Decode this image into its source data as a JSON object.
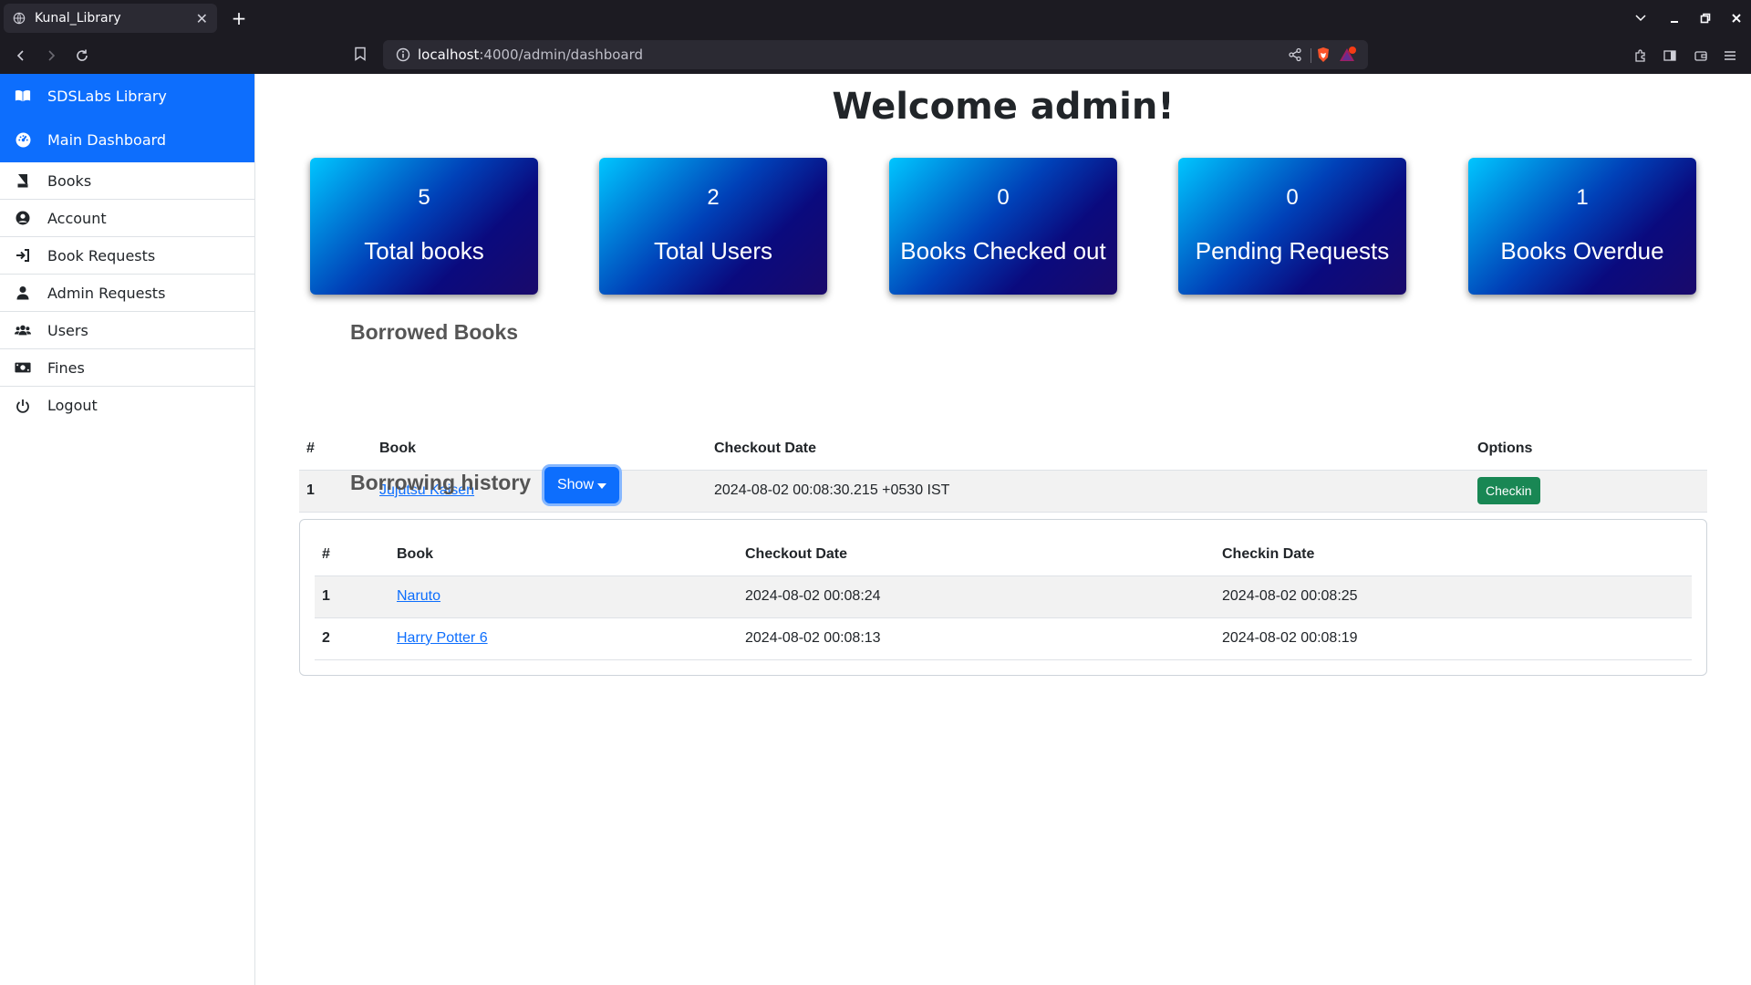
{
  "browser": {
    "tab_title": "Kunal_Library",
    "url_host": "localhost",
    "url_path": ":4000/admin/dashboard"
  },
  "sidebar": {
    "brand": "SDSLabs Library",
    "items": [
      {
        "label": "Main Dashboard",
        "icon": "dashboard-icon",
        "active": true
      },
      {
        "label": "Books",
        "icon": "book-icon"
      },
      {
        "label": "Account",
        "icon": "user-circle-icon"
      },
      {
        "label": "Book Requests",
        "icon": "sign-in-icon"
      },
      {
        "label": "Admin Requests",
        "icon": "user-tie-icon"
      },
      {
        "label": "Users",
        "icon": "users-icon"
      },
      {
        "label": "Fines",
        "icon": "money-icon"
      },
      {
        "label": "Logout",
        "icon": "power-icon"
      }
    ]
  },
  "main": {
    "welcome": "Welcome admin!",
    "stats": [
      {
        "value": "5",
        "label": "Total books"
      },
      {
        "value": "2",
        "label": "Total Users"
      },
      {
        "value": "0",
        "label": "Books Checked out"
      },
      {
        "value": "0",
        "label": "Pending Requests"
      },
      {
        "value": "1",
        "label": "Books Overdue"
      }
    ],
    "borrowed": {
      "title": "Borrowed Books",
      "headers": [
        "#",
        "Book",
        "Checkout Date",
        "Options"
      ],
      "rows": [
        {
          "idx": "1",
          "book": "Jujutsu Kaisen",
          "checkout": "2024-08-02 00:08:30.215 +0530 IST",
          "action": "Checkin"
        }
      ]
    },
    "history": {
      "title": "Borrowing history",
      "toggle_label": "Show",
      "headers": [
        "#",
        "Book",
        "Checkout Date",
        "Checkin Date"
      ],
      "rows": [
        {
          "idx": "1",
          "book": "Naruto",
          "checkout": "2024-08-02 00:08:24",
          "checkin": "2024-08-02 00:08:25"
        },
        {
          "idx": "2",
          "book": "Harry Potter 6",
          "checkout": "2024-08-02 00:08:13",
          "checkin": "2024-08-02 00:08:19"
        }
      ]
    }
  },
  "colors": {
    "primary": "#0d6efd",
    "success": "#198754",
    "chrome_bg": "#1c1b22"
  }
}
